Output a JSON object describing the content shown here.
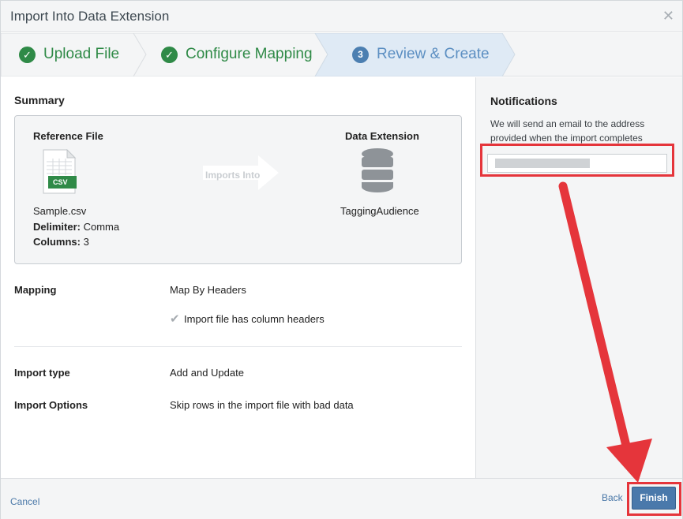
{
  "dialog": {
    "title": "Import Into Data Extension"
  },
  "steps": [
    {
      "label": "Upload File",
      "state": "complete"
    },
    {
      "label": "Configure Mapping",
      "state": "complete"
    },
    {
      "label": "Review & Create",
      "number": "3",
      "state": "active"
    }
  ],
  "summary": {
    "heading": "Summary",
    "reference_file_title": "Reference File",
    "file_badge": "CSV",
    "file_name": "Sample.csv",
    "delimiter_label": "Delimiter:",
    "delimiter_value": "Comma",
    "columns_label": "Columns:",
    "columns_value": "3",
    "imports_into": "Imports Into",
    "data_extension_title": "Data Extension",
    "data_extension_name": "TaggingAudience"
  },
  "mapping": {
    "label": "Mapping",
    "value": "Map By Headers",
    "check_text": "Import file has column headers"
  },
  "import_type": {
    "label": "Import type",
    "value": "Add and Update"
  },
  "import_options": {
    "label": "Import Options",
    "value": "Skip rows in the import file with bad data"
  },
  "notifications": {
    "heading": "Notifications",
    "text": "We will send an email to the address provided when the import completes"
  },
  "footer": {
    "cancel": "Cancel",
    "back": "Back",
    "finish": "Finish"
  },
  "colors": {
    "accent": "#4a79ab",
    "complete": "#2f8a47",
    "highlight": "#e5353b"
  }
}
